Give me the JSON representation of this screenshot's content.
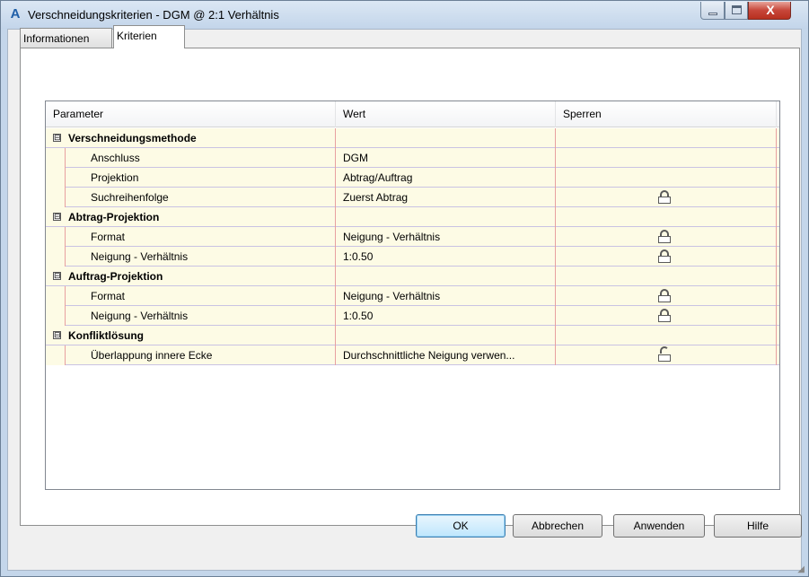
{
  "window": {
    "title": "Verschneidungskriterien - DGM @ 2:1 Verhältnis",
    "app_icon": "A",
    "controls": {
      "minimize": "minimize-icon",
      "maximize": "maximize-icon",
      "close": "X"
    }
  },
  "tabs": [
    {
      "label": "Informationen",
      "active": false
    },
    {
      "label": "Kriterien",
      "active": true
    }
  ],
  "grid": {
    "columns": [
      "Parameter",
      "Wert",
      "Sperren"
    ],
    "groups": [
      {
        "label": "Verschneidungsmethode",
        "expander": "⊟",
        "rows": [
          {
            "parameter": "Anschluss",
            "value": "DGM",
            "lock": ""
          },
          {
            "parameter": "Projektion",
            "value": "Abtrag/Auftrag",
            "lock": ""
          },
          {
            "parameter": "Suchreihenfolge",
            "value": "Zuerst Abtrag",
            "lock": "locked"
          }
        ]
      },
      {
        "label": "Abtrag-Projektion",
        "expander": "⊟",
        "rows": [
          {
            "parameter": "Format",
            "value": "Neigung - Verhältnis",
            "lock": "locked"
          },
          {
            "parameter": "Neigung - Verhältnis",
            "value": "1:0.50",
            "lock": "locked"
          }
        ]
      },
      {
        "label": "Auftrag-Projektion",
        "expander": "⊟",
        "rows": [
          {
            "parameter": "Format",
            "value": "Neigung - Verhältnis",
            "lock": "locked"
          },
          {
            "parameter": "Neigung - Verhältnis",
            "value": "1:0.50",
            "lock": "locked"
          }
        ]
      },
      {
        "label": "Konfliktlösung",
        "expander": "⊟",
        "rows": [
          {
            "parameter": "Überlappung innere Ecke",
            "value": "Durchschnittliche Neigung verwen...",
            "lock": "unlocked"
          }
        ]
      }
    ]
  },
  "buttons": {
    "ok": "OK",
    "cancel": "Abbrechen",
    "apply": "Anwenden",
    "help": "Hilfe"
  }
}
